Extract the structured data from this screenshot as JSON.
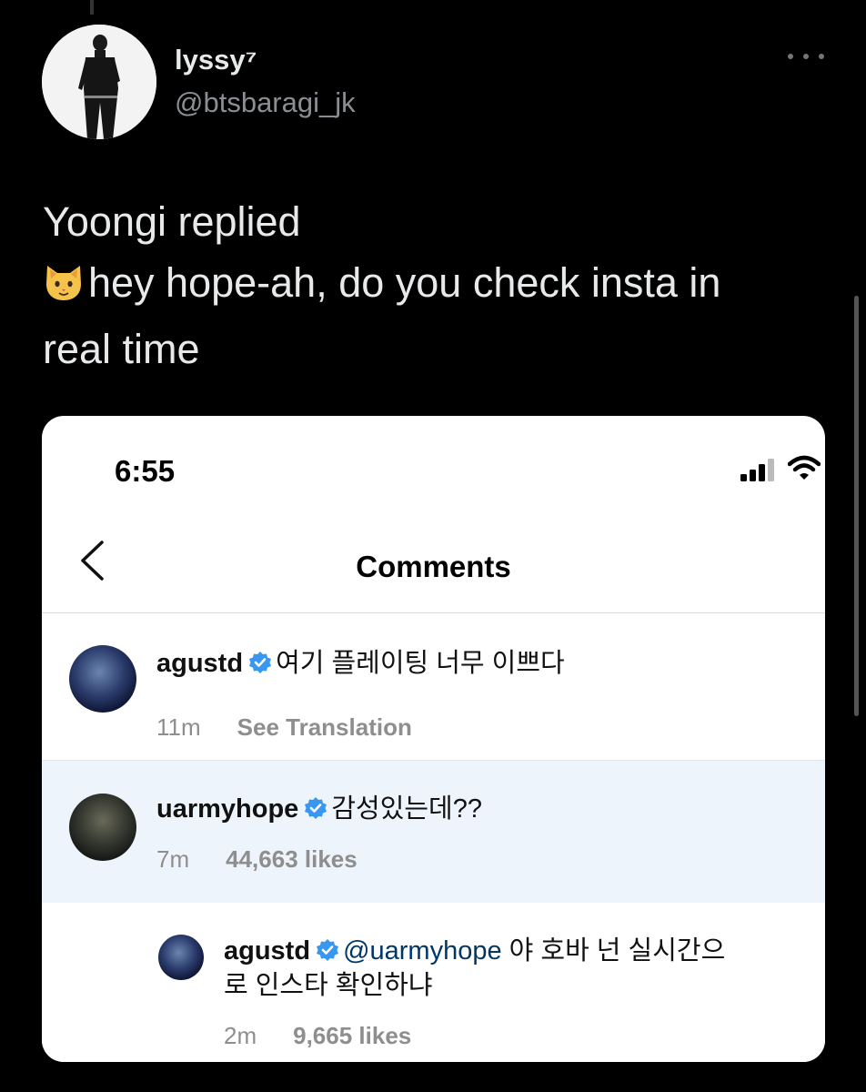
{
  "author": {
    "display_name": "lyssy⁷",
    "handle": "@btsbaragi_jk"
  },
  "tweet": {
    "line1": "Yoongi replied",
    "line2_emoji": "cat-face-icon",
    "line2": "hey hope-ah, do you check insta in",
    "line3": "real time"
  },
  "screenshot": {
    "status_time": "6:55",
    "title": "Comments",
    "comments": [
      {
        "user": "agustd",
        "text": "여기 플레이팅 너무 이쁘다",
        "time": "11m",
        "action": "See Translation"
      },
      {
        "user": "uarmyhope",
        "text": "감성있는데??",
        "time": "7m",
        "action": "44,663 likes"
      },
      {
        "user": "agustd",
        "mention": "@uarmyhope",
        "text_line1": "야 호바 넌 실시간으",
        "text_line2": "로 인스타 확인하냐",
        "time": "2m",
        "action": "9,665 likes"
      }
    ]
  },
  "colors": {
    "background": "#000000",
    "verified": "#3897f0",
    "mention": "#00376b",
    "highlight_row": "#eef4fb"
  }
}
